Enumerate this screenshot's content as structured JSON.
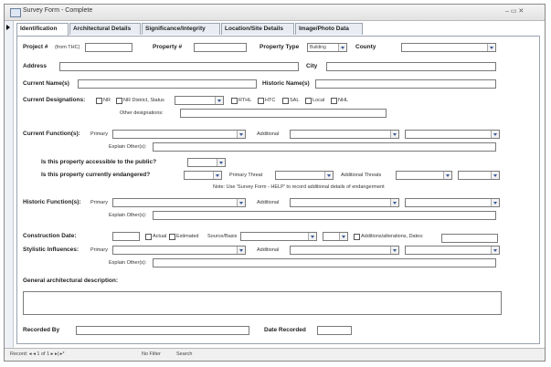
{
  "window": {
    "title": "Survey Form - Complete",
    "controls": "– ▭ ✕"
  },
  "tabs": [
    "Identification",
    "Architectural Details",
    "Significance/Integrity",
    "Location/Site Details",
    "Image/Photo Data"
  ],
  "form": {
    "project_label": "Project #",
    "project_sub": "(from THC)",
    "property_no_label": "Property #",
    "property_type_label": "Property Type",
    "property_type_value": "Building",
    "county_label": "County",
    "address_label": "Address",
    "city_label": "City",
    "current_names_label": "Current Name(s)",
    "historic_names_label": "Historic Name(s)",
    "designations_label": "Current Designations:",
    "des_nr": "NR",
    "des_nr_district": "NR District, Status",
    "des_rthl": "RTHL",
    "des_htc": "HTC",
    "des_sal": "SAL",
    "des_local": "Local",
    "des_nhl": "NHL",
    "other_designations": "Other designations:",
    "current_functions_label": "Current Function(s):",
    "primary": "Primary",
    "additional": "Additional",
    "explain_other": "Explain Other(s):",
    "accessible_label": "Is this property accessible to the public?",
    "endangered_label": "Is this property currently endangered?",
    "primary_threat": "Primary Threat",
    "additional_threats": "Additional Threats",
    "endangered_note": "Note: Use 'Survey Form - HELP' to record additional details of endangerment",
    "historic_functions_label": "Historic Function(s):",
    "construction_date_label": "Construction Date:",
    "actual": "Actual",
    "estimated": "Estimated",
    "source_basis": "Source/Basis",
    "additions_dates": "Additions/alterations, Dates:",
    "stylistic_label": "Stylistic Influences:",
    "general_desc_label": "General architectural description:",
    "recorded_by_label": "Recorded By",
    "date_recorded_label": "Date Recorded"
  },
  "statusbar": {
    "record": "Record: ◂  ◂  1 of 1  ▸  ▸|  ▸*",
    "filter": "No Filter",
    "search": "Search"
  }
}
